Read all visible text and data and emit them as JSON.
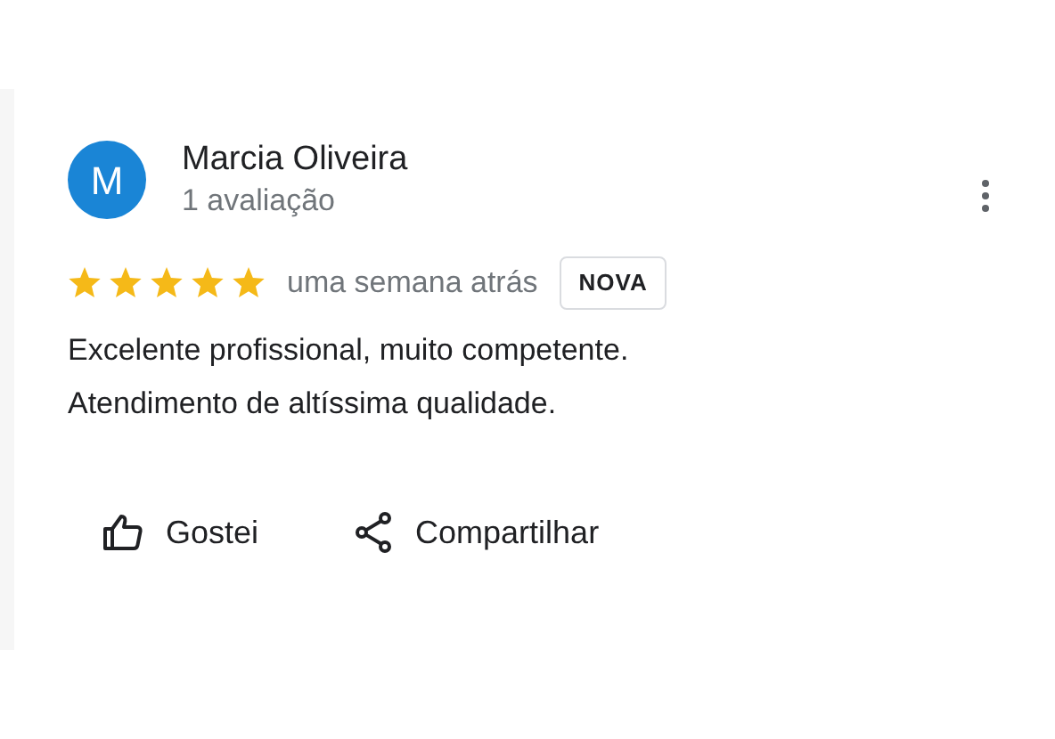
{
  "review": {
    "avatar_letter": "M",
    "author": "Marcia Oliveira",
    "review_count": "1 avaliação",
    "stars": 5,
    "time": "uma semana atrás",
    "badge": "NOVA",
    "text": "Excelente profissional, muito competente. Atendimento de altíssima qualidade.",
    "actions": [
      {
        "kind": "like",
        "label": "Gostei"
      },
      {
        "kind": "share",
        "label": "Compartilhar"
      }
    ]
  }
}
